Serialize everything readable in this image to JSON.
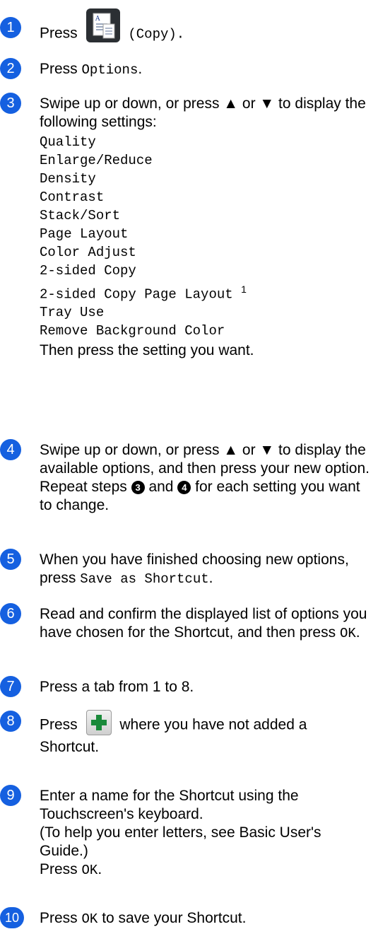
{
  "steps": [
    {
      "num": "1",
      "press": "Press",
      "icon_label": "(Copy)."
    },
    {
      "num": "2",
      "press": "Press",
      "options": "Options",
      "dot": "."
    },
    {
      "num": "3",
      "intro": "Swipe up or down, or press ▲ or ▼ to display the following settings:",
      "settings": [
        "Quality",
        "Enlarge/Reduce",
        "Density",
        "Contrast",
        "Stack/Sort",
        "Page Layout",
        "Color Adjust",
        "2-sided Copy",
        "2-sided Copy Page Layout",
        "Tray Use",
        "Remove Background Color"
      ],
      "footnote_mark": "1",
      "outro": "Then press the setting you want."
    },
    {
      "num": "4",
      "text": "Swipe up or down, or press ▲ or ▼ to display the available options, and then press your new option.",
      "repeat_a": "Repeat steps",
      "ref3": "3",
      "repeat_and": "and",
      "ref4": "4",
      "repeat_b": "for each setting you want to change."
    },
    {
      "num": "5",
      "text": "When you have finished choosing new options, press",
      "button": "Save as Shortcut",
      "dot": "."
    },
    {
      "num": "6",
      "text": "Read and confirm the displayed list of options you have chosen for the Shortcut, and then press",
      "button": "OK",
      "dot": "."
    },
    {
      "num": "7",
      "text": "Press a tab from 1 to 8."
    },
    {
      "num": "8",
      "press": "Press",
      "text_after": "where you have not added a Shortcut."
    },
    {
      "num": "9",
      "text": "Enter a name for the Shortcut using the Touchscreen's keyboard.",
      "help": "(To help you enter letters, see Basic User's Guide.)",
      "press": "Press",
      "button": "OK",
      "dot": "."
    },
    {
      "num": "10",
      "press": "Press",
      "button": "OK",
      "text_after": "to save your Shortcut."
    }
  ],
  "colors": {
    "badge": "#1560e0",
    "icon_dark": "#2b2f33",
    "plus_green": "#1a8a3a"
  },
  "icons": {
    "copy": "copy-icon",
    "plus": "add-shortcut-plus-icon"
  }
}
